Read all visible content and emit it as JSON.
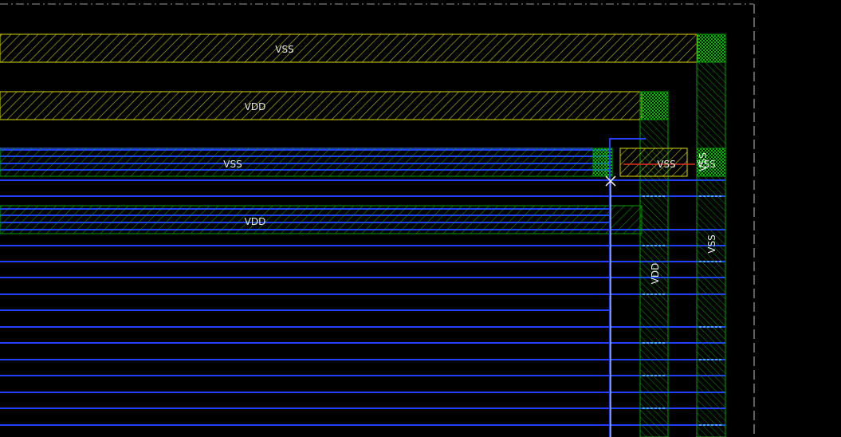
{
  "view": {
    "background": "#000000",
    "colors": {
      "metal_top": "#d8d800",
      "metal_mid": "#00a000",
      "metal_low": "#2040ff",
      "via_fill": "#00b000",
      "label": "#e8e8e8",
      "cursor": "#ffffff",
      "ruler": "#e03020",
      "boundary": "#c0c0c0"
    }
  },
  "labels": {
    "rail_vss_top": "VSS",
    "rail_vdd_top": "VDD",
    "rail_vss_mid": "VSS",
    "rail_vdd_mid": "VDD",
    "stripe_vdd": "VDD",
    "stripe_vss": "VSS",
    "pin_vss_a": "VSS",
    "pin_vss_b": "VSS",
    "pin_vss_c": "VSS"
  }
}
